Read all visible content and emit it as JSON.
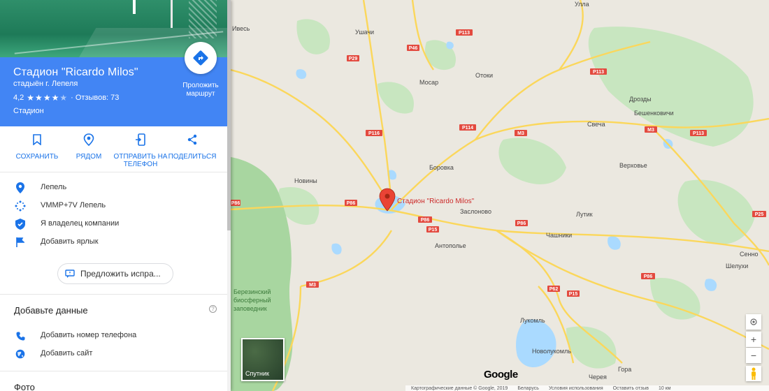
{
  "place": {
    "title": "Стадион \"Ricardo Milos\"",
    "subtitle": "стадыён г. Лепеля",
    "rating": "4,2",
    "stars": 4.2,
    "reviews": "· Отзывов: 73",
    "type": "Стадион",
    "route_label": "Проложить маршрут"
  },
  "actions": [
    {
      "label": "СОХРАНИТЬ",
      "icon": "bookmark-icon"
    },
    {
      "label": "РЯДОМ",
      "icon": "nearby-icon"
    },
    {
      "label": "ОТПРАВИТЬ НА ТЕЛЕФОН",
      "icon": "send-to-phone-icon"
    },
    {
      "label": "ПОДЕЛИТЬСЯ",
      "icon": "share-icon"
    }
  ],
  "info": [
    {
      "text": "Лепель",
      "icon": "location-pin-icon"
    },
    {
      "text": "VMMP+7V Лепель",
      "icon": "plus-code-icon"
    },
    {
      "text": "Я владелец компании",
      "icon": "verified-shield-icon"
    },
    {
      "text": "Добавить ярлык",
      "icon": "flag-icon"
    }
  ],
  "suggest_label": "Предложить испра...",
  "add_data": {
    "title": "Добавьте данные",
    "rows": [
      {
        "text": "Добавить номер телефона",
        "icon": "phone-icon"
      },
      {
        "text": "Добавить сайт",
        "icon": "globe-icon"
      }
    ]
  },
  "photos_title": "Фото",
  "map": {
    "marker_label": "Стадион \"Ricardo Milos\"",
    "cities": [
      "Ивесь",
      "Ушачи",
      "Улла",
      "Мосар",
      "Отоки",
      "Дрозды",
      "Бешенковичи",
      "Свеча",
      "Боровка",
      "Верховье",
      "Новины",
      "Заслоново",
      "Лутик",
      "Чашники",
      "Антополье",
      "Сенно",
      "Шелухи",
      "Лукомль",
      "Новолукомль",
      "Гора",
      "Черея"
    ],
    "reserve": [
      "Березинский",
      "биосферный",
      "заповедник"
    ],
    "roads": [
      "P113",
      "P46",
      "P29",
      "P113",
      "P114",
      "P116",
      "M3",
      "M3",
      "P113",
      "P86",
      "P86",
      "P15",
      "P86",
      "P86",
      "P25",
      "M3",
      "P62",
      "P15",
      "P86"
    ],
    "satellite_label": "Спутник",
    "logo": "Google",
    "footer": [
      "Картографические данные © Google, 2019",
      "Беларусь",
      "Условия использования",
      "Оставить отзыв",
      "10 км"
    ],
    "colors": {
      "water": "#aadaff",
      "forest": "#c8e6c0",
      "reserve": "#a8d6a0",
      "road": "#fbd75b",
      "marker": "#ea4335"
    }
  }
}
